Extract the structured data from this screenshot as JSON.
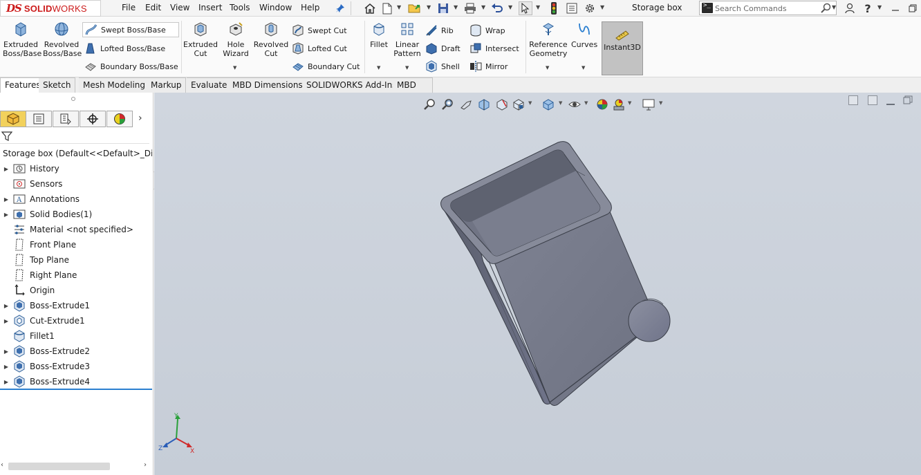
{
  "app": {
    "logo_ds": "DS",
    "logo_brand_bold": "SOLID",
    "logo_brand": "WORKS",
    "brand_color": "#cc1a1a"
  },
  "menu": [
    "File",
    "Edit",
    "View",
    "Insert",
    "Tools",
    "Window",
    "Help"
  ],
  "document_title": "Storage box",
  "search": {
    "placeholder": "Search Commands"
  },
  "commands": {
    "extruded_boss": [
      "Extruded",
      "Boss/Base"
    ],
    "revolved_boss": [
      "Revolved",
      "Boss/Base"
    ],
    "swept_boss": "Swept Boss/Base",
    "lofted_boss": "Lofted Boss/Base",
    "boundary_boss": "Boundary Boss/Base",
    "extruded_cut": [
      "Extruded",
      "Cut"
    ],
    "hole_wizard": [
      "Hole",
      "Wizard"
    ],
    "revolved_cut": [
      "Revolved",
      "Cut"
    ],
    "swept_cut": "Swept Cut",
    "lofted_cut": "Lofted Cut",
    "boundary_cut": "Boundary Cut",
    "fillet": "Fillet",
    "linear_pattern": [
      "Linear",
      "Pattern"
    ],
    "rib": "Rib",
    "draft": "Draft",
    "shell": "Shell",
    "wrap": "Wrap",
    "intersect": "Intersect",
    "mirror": "Mirror",
    "reference_geometry": [
      "Reference",
      "Geometry"
    ],
    "curves": "Curves",
    "instant3d": "Instant3D"
  },
  "tabs": [
    "Features",
    "Sketch",
    "Mesh Modeling",
    "Markup",
    "Evaluate",
    "MBD Dimensions",
    "SOLIDWORKS Add-Ins",
    "MBD"
  ],
  "active_tab": "Features",
  "feature_tree": {
    "root": "Storage box  (Default<<Default>_Disp",
    "items": [
      {
        "label": "History",
        "expandable": true,
        "icon": "history-folder-icon"
      },
      {
        "label": "Sensors",
        "expandable": false,
        "icon": "sensors-icon"
      },
      {
        "label": "Annotations",
        "expandable": true,
        "icon": "annotations-icon"
      },
      {
        "label": "Solid Bodies(1)",
        "expandable": true,
        "icon": "solid-bodies-icon"
      },
      {
        "label": "Material <not specified>",
        "expandable": false,
        "icon": "material-icon"
      },
      {
        "label": "Front Plane",
        "expandable": false,
        "icon": "plane-icon"
      },
      {
        "label": "Top Plane",
        "expandable": false,
        "icon": "plane-icon"
      },
      {
        "label": "Right Plane",
        "expandable": false,
        "icon": "plane-icon"
      },
      {
        "label": "Origin",
        "expandable": false,
        "icon": "origin-icon"
      },
      {
        "label": "Boss-Extrude1",
        "expandable": true,
        "icon": "boss-extrude-icon"
      },
      {
        "label": "Cut-Extrude1",
        "expandable": true,
        "icon": "cut-extrude-icon"
      },
      {
        "label": "Fillet1",
        "expandable": false,
        "icon": "fillet-icon"
      },
      {
        "label": "Boss-Extrude2",
        "expandable": true,
        "icon": "boss-extrude-icon"
      },
      {
        "label": "Boss-Extrude3",
        "expandable": true,
        "icon": "boss-extrude-icon"
      },
      {
        "label": "Boss-Extrude4",
        "expandable": true,
        "icon": "boss-extrude-icon"
      }
    ]
  },
  "triad": {
    "x": "X",
    "y": "Y",
    "z": "Z"
  },
  "colors": {
    "viewport_top": "#d0d6df",
    "model_face": "#7a7e8c",
    "model_dark": "#5e6270",
    "active_panel_tab": "#f2d15c",
    "tree_end_bar": "#2b7fd0"
  }
}
